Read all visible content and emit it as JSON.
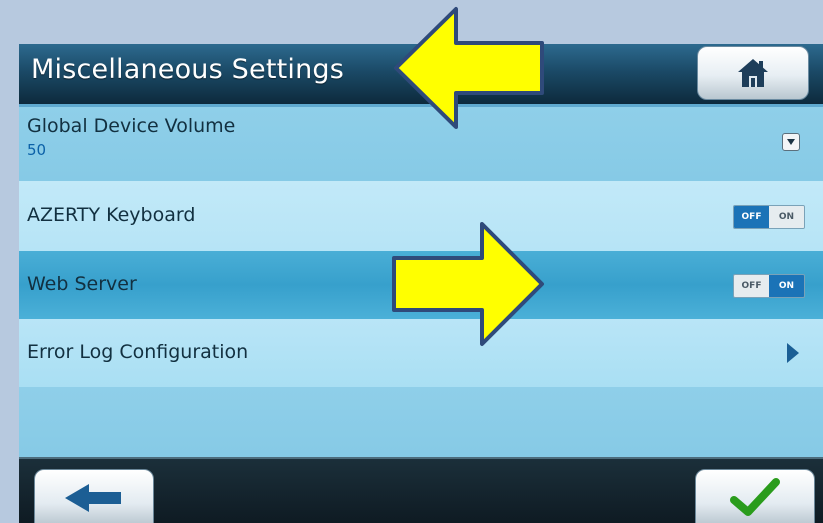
{
  "header": {
    "title": "Miscellaneous Settings",
    "home_icon": "home-icon"
  },
  "rows": [
    {
      "label": "Global Device Volume",
      "value": "50",
      "control": "dropdown"
    },
    {
      "label": "AZERTY Keyboard",
      "control": "toggle",
      "off": "OFF",
      "on": "ON",
      "state": "off"
    },
    {
      "label": "Web Server",
      "control": "toggle",
      "off": "OFF",
      "on": "ON",
      "state": "on",
      "selected": true
    },
    {
      "label": "Error Log Configuration",
      "control": "chevron"
    }
  ],
  "footer": {
    "back_icon": "back-arrow-icon",
    "confirm_icon": "checkmark-icon"
  },
  "annotations": {
    "arrow_color": "#ffff00",
    "arrow_outline": "#2f4a7a"
  }
}
